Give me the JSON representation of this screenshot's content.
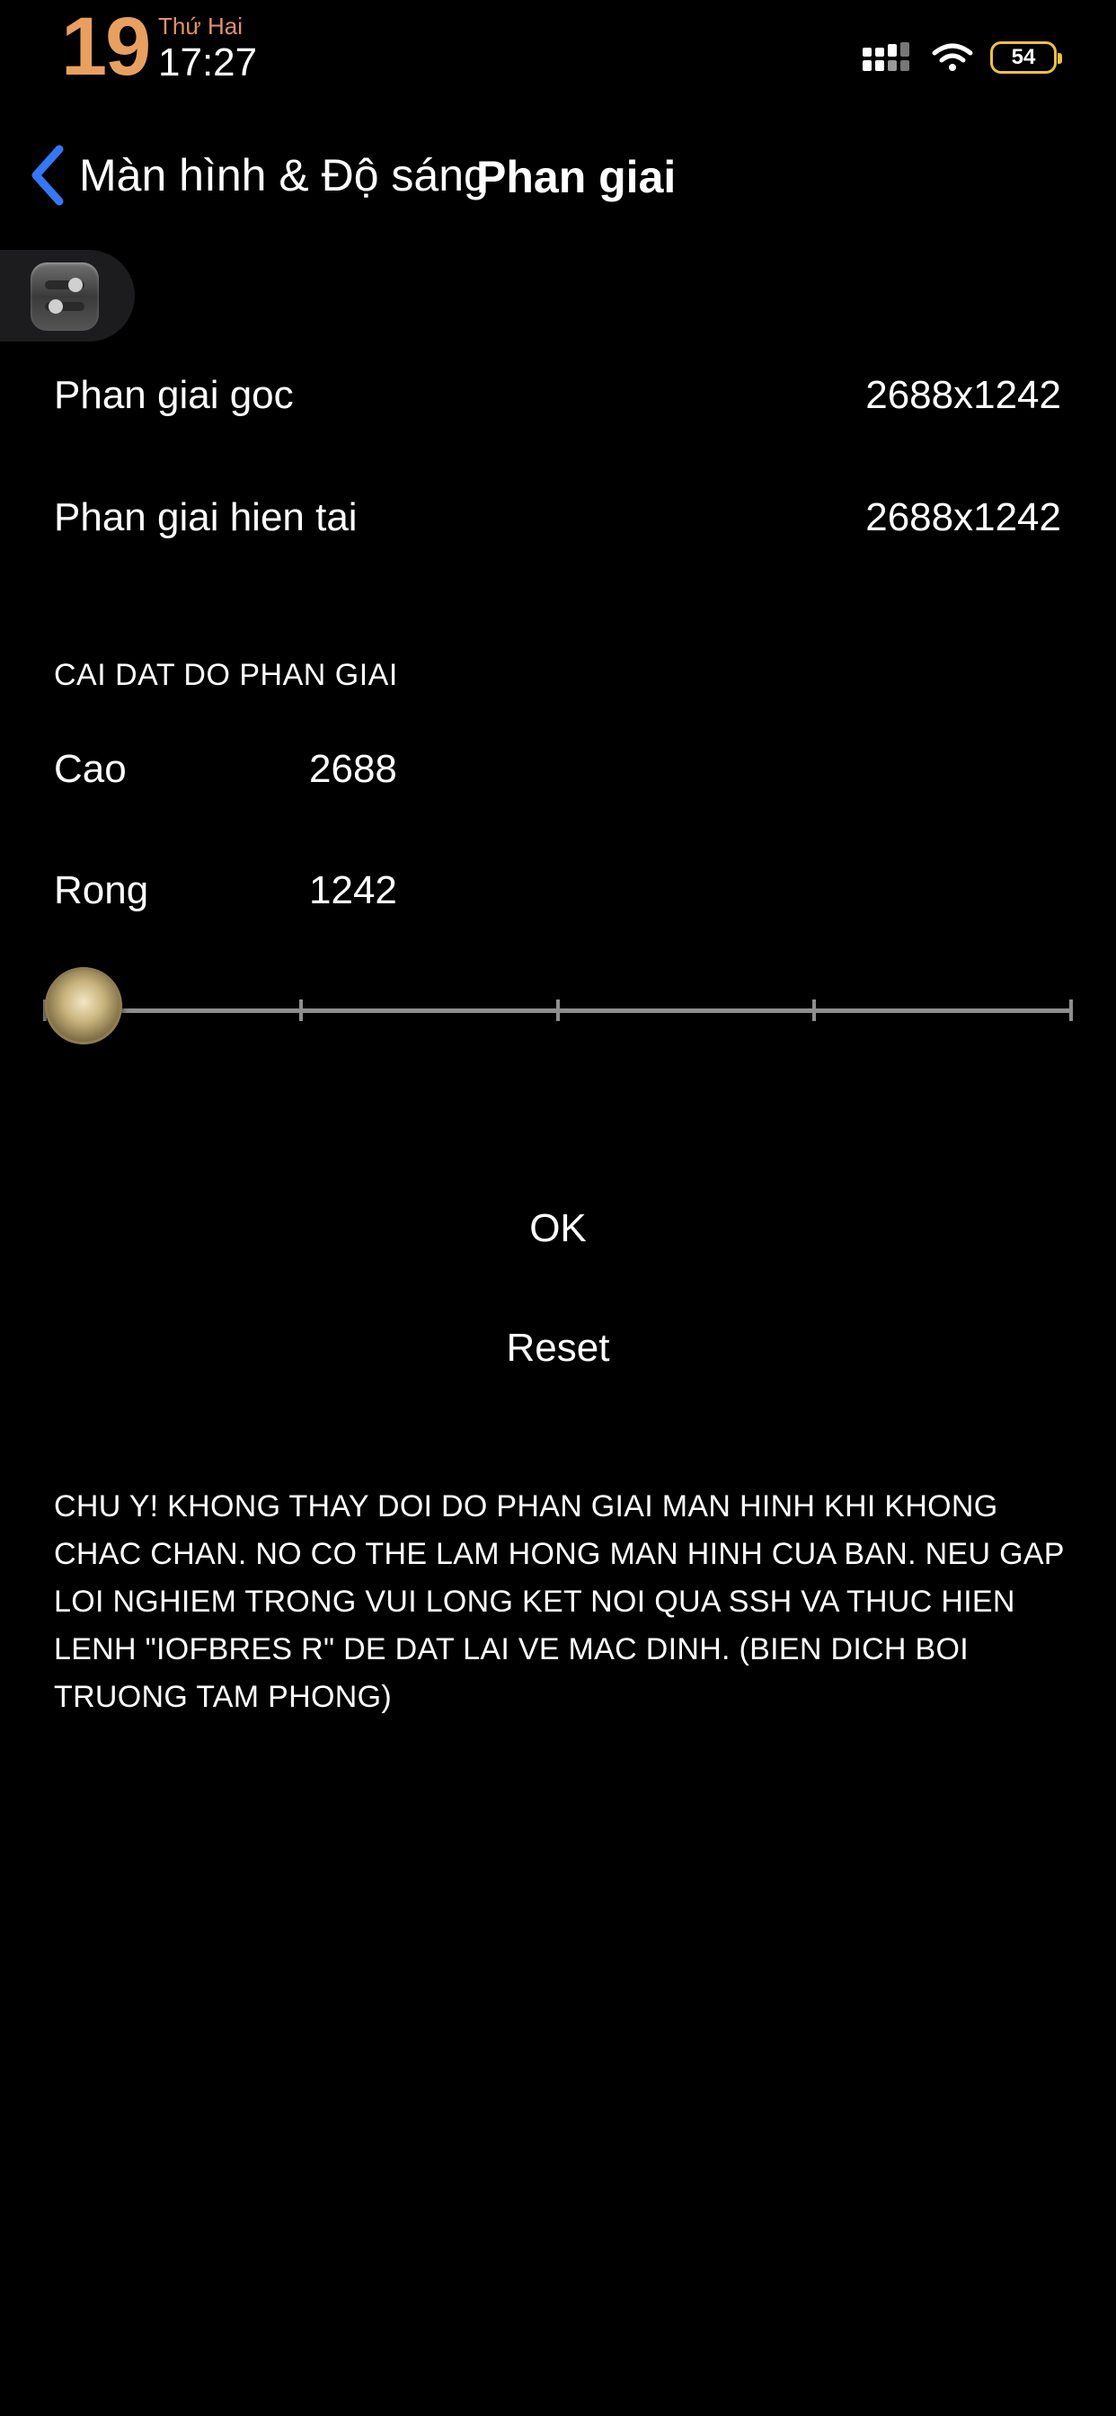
{
  "status_bar": {
    "day": "19",
    "weekday": "Thứ Hai",
    "time": "17:27",
    "battery": "54",
    "icons": [
      "signal-icon",
      "wifi-icon",
      "battery-icon"
    ],
    "colors": {
      "day": "#e8a060",
      "weekday": "#e09070",
      "battery": "#f0c040"
    }
  },
  "nav": {
    "back_label": "Màn hình & Độ sáng",
    "title": "Phan giai",
    "back_icon": "chevron-back-icon",
    "accent": "#3478f6"
  },
  "info_rows": [
    {
      "label": "Phan giai goc",
      "value": "2688x1242"
    },
    {
      "label": "Phan giai hien tai",
      "value": "2688x1242"
    }
  ],
  "settings": {
    "header": "CAI DAT DO PHAN GIAI",
    "fields": [
      {
        "label": "Cao",
        "value": "2688"
      },
      {
        "label": "Rong",
        "value": "1242"
      }
    ],
    "slider": {
      "stops": 5,
      "selected_index": 0
    }
  },
  "buttons": {
    "ok": "OK",
    "reset": "Reset"
  },
  "warning": "CHU Y! KHONG THAY DOI DO PHAN GIAI MAN HINH KHI KHONG CHAC CHAN. NO CO THE LAM HONG MAN HINH CUA BAN. NEU GAP LOI NGHIEM TRONG VUI LONG KET NOI QUA SSH VA THUC HIEN LENH \"IOFBRES R\" DE DAT LAI VE MAC DINH. (BIEN DICH BOI TRUONG TAM PHONG)"
}
